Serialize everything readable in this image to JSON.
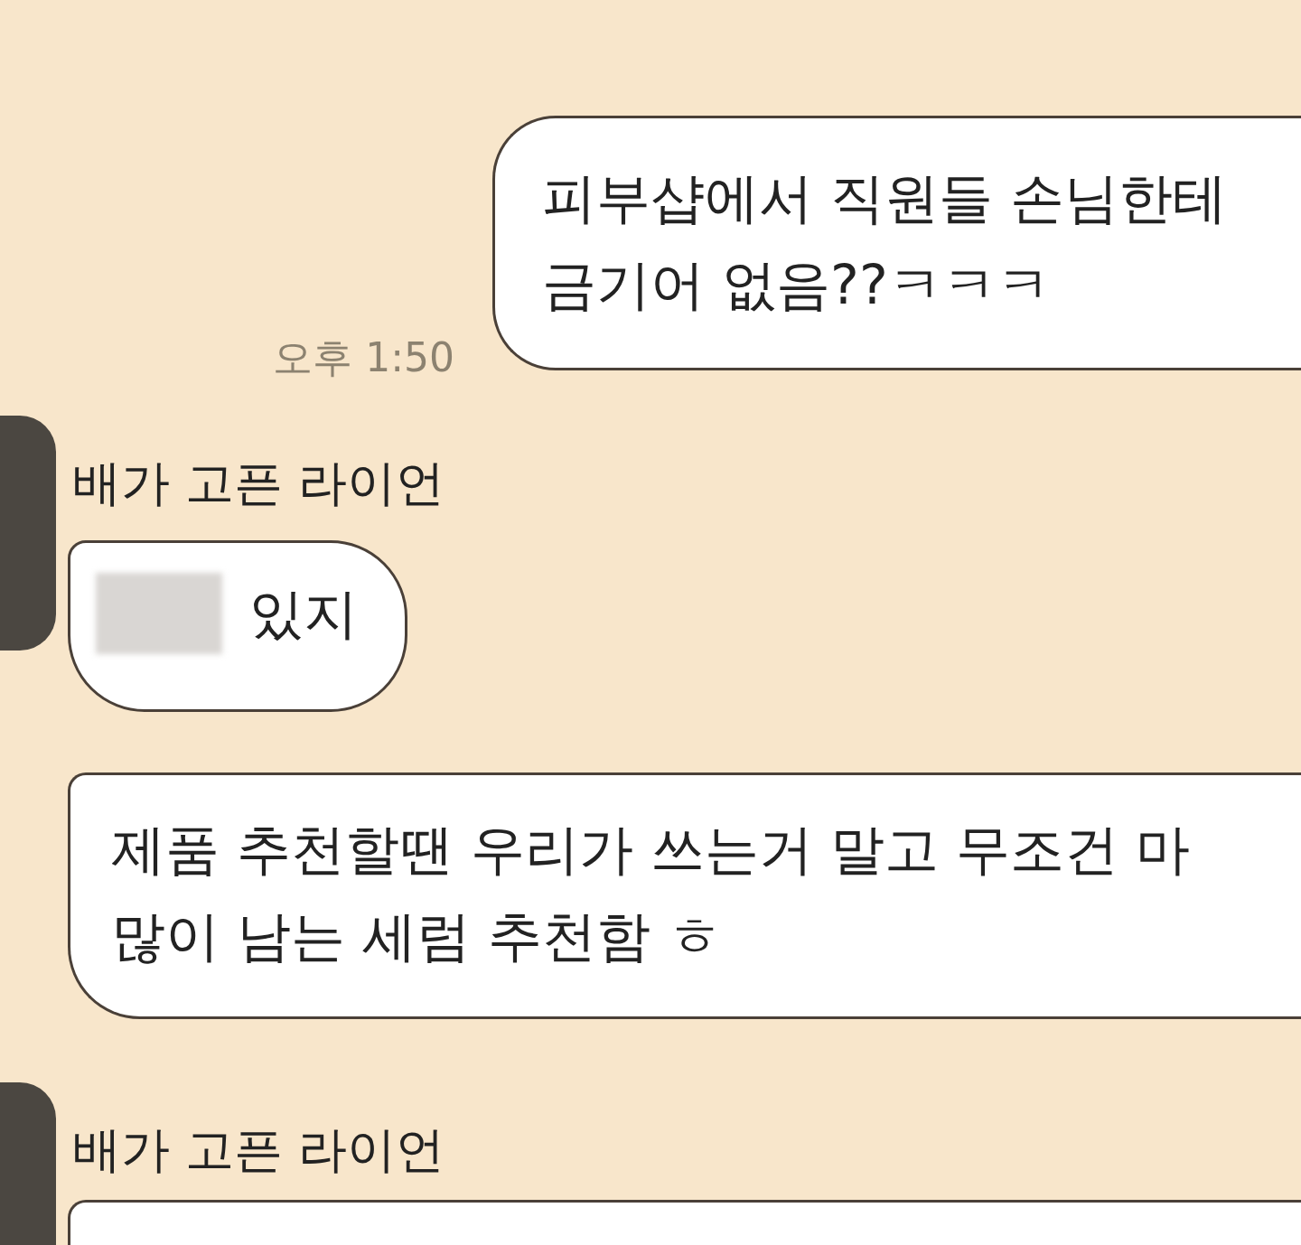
{
  "messages": [
    {
      "kind": "outgoing",
      "lines": [
        "피부샵에서 직원들 손님한테",
        "금기어 없음??ㅋㅋㅋ"
      ],
      "time": "오후 1:50"
    },
    {
      "kind": "sender",
      "name": "배가 고픈 라이언"
    },
    {
      "kind": "incoming",
      "redacted": true,
      "lines": [
        "있지"
      ]
    },
    {
      "kind": "incoming",
      "redacted": false,
      "lines": [
        "제품 추천할땐 우리가 쓰는거 말고 무조건 마",
        "많이 남는 세럼 추천함 ㅎ"
      ]
    },
    {
      "kind": "sender",
      "name": "배가 고픈 라이언"
    },
    {
      "kind": "cut_bubble"
    }
  ]
}
